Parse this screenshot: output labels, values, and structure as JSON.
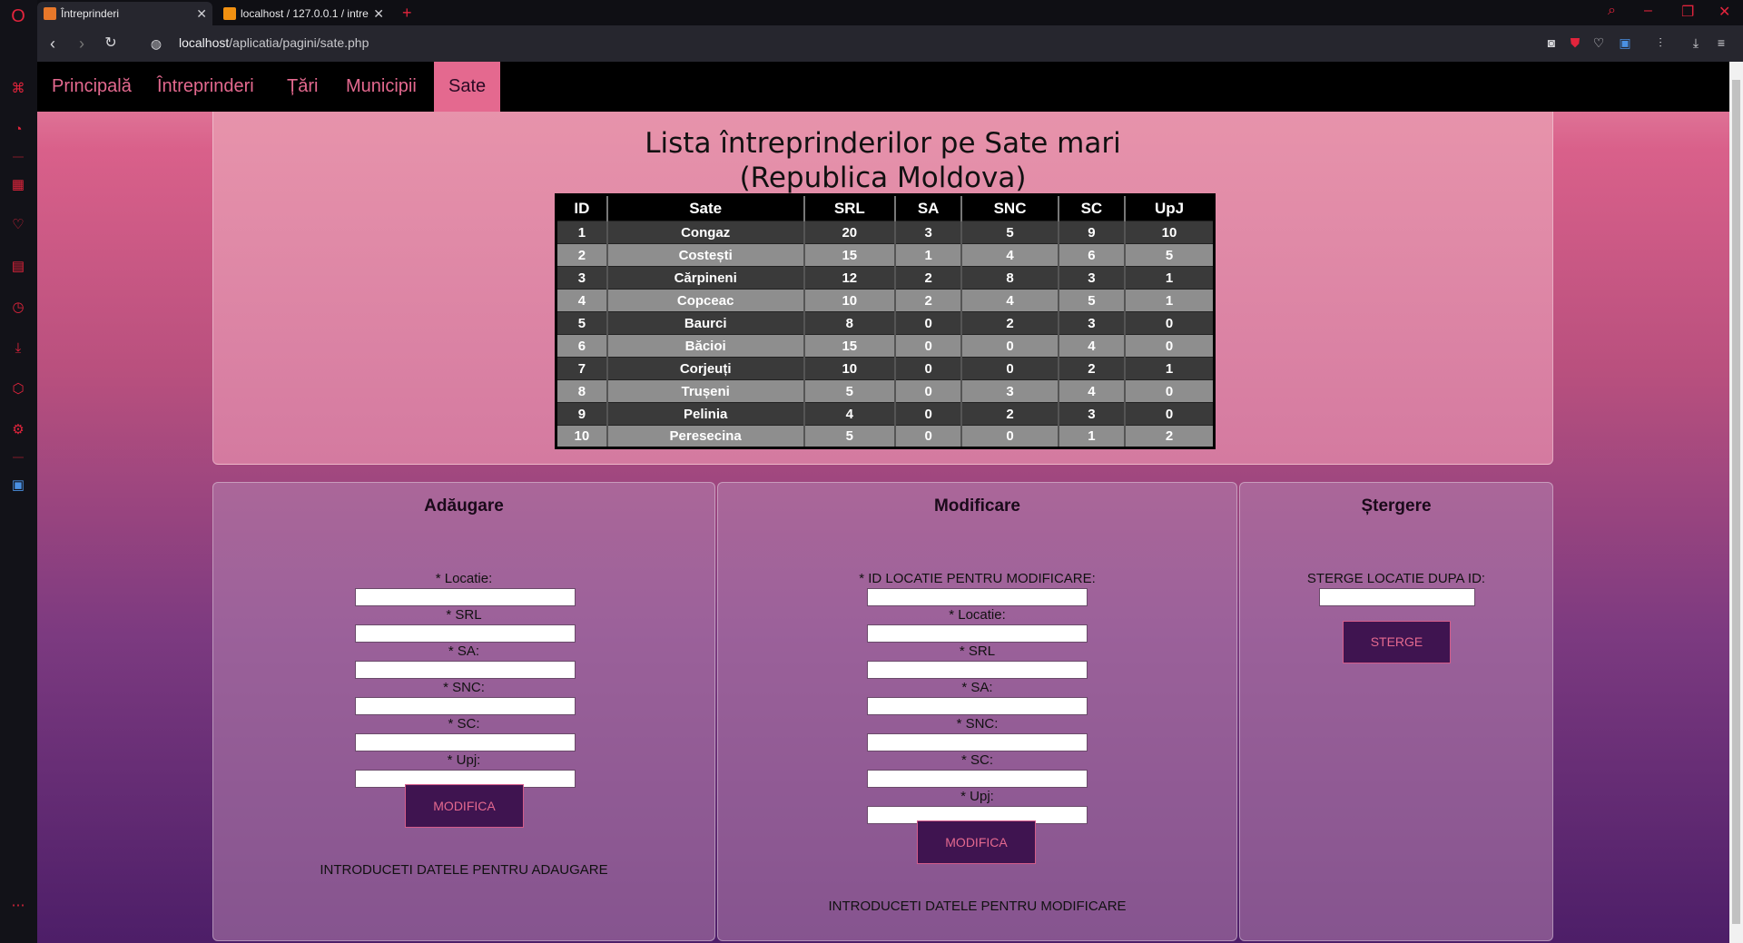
{
  "browser": {
    "tabs": [
      {
        "title": "Întreprinderi",
        "active": true
      },
      {
        "title": "localhost / 127.0.0.1 / intre",
        "active": false
      }
    ],
    "url_host": "localhost",
    "url_path": "/aplicatia/pagini/sate.php",
    "accent_color": "#e1243c"
  },
  "nav": {
    "items": [
      "Principală",
      "Întreprinderi",
      "Țări",
      "Municipii",
      "Sate"
    ],
    "active": "Sate"
  },
  "title_line1": "Lista întreprinderilor pe Sate mari",
  "title_line2": "(Republica Moldova)",
  "table": {
    "headers": [
      "ID",
      "Sate",
      "SRL",
      "SA",
      "SNC",
      "SC",
      "UpJ"
    ],
    "rows": [
      [
        "1",
        "Congaz",
        "20",
        "3",
        "5",
        "9",
        "10"
      ],
      [
        "2",
        "Costești",
        "15",
        "1",
        "4",
        "6",
        "5"
      ],
      [
        "3",
        "Cărpineni",
        "12",
        "2",
        "8",
        "3",
        "1"
      ],
      [
        "4",
        "Copceac",
        "10",
        "2",
        "4",
        "5",
        "1"
      ],
      [
        "5",
        "Baurci",
        "8",
        "0",
        "2",
        "3",
        "0"
      ],
      [
        "6",
        "Băcioi",
        "15",
        "0",
        "0",
        "4",
        "0"
      ],
      [
        "7",
        "Corjeuți",
        "10",
        "0",
        "0",
        "2",
        "1"
      ],
      [
        "8",
        "Trușeni",
        "5",
        "0",
        "3",
        "4",
        "0"
      ],
      [
        "9",
        "Pelinia",
        "4",
        "0",
        "2",
        "3",
        "0"
      ],
      [
        "10",
        "Peresecina",
        "5",
        "0",
        "0",
        "1",
        "2"
      ]
    ]
  },
  "add": {
    "heading": "Adăugare",
    "labels": [
      "* Locatie:",
      "* SRL",
      "* SA:",
      "* SNC:",
      "* SC:",
      "* Upj:"
    ],
    "button": "MODIFICA",
    "note": "INTRODUCETI DATELE PENTRU ADAUGARE"
  },
  "modify": {
    "heading": "Modificare",
    "labels": [
      "* ID LOCATIE PENTRU MODIFICARE:",
      "* Locatie:",
      "* SRL",
      "* SA:",
      "* SNC:",
      "* SC:",
      "* Upj:"
    ],
    "button": "MODIFICA",
    "note": "INTRODUCETI DATELE PENTRU MODIFICARE"
  },
  "delete": {
    "heading": "Ștergere",
    "label": "STERGE LOCATIE DUPA ID:",
    "button": "STERGE"
  }
}
